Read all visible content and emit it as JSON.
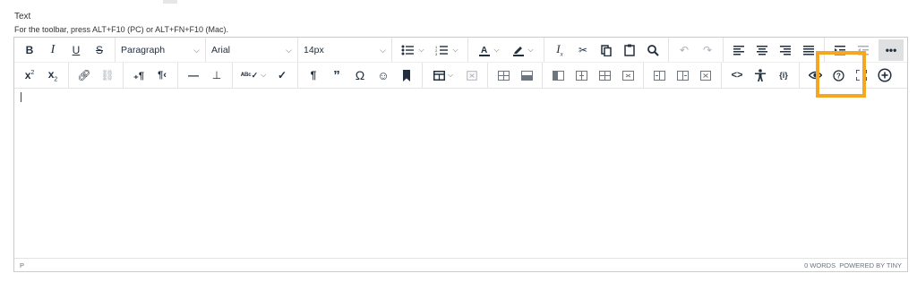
{
  "field": {
    "label": "Text",
    "hint": "For the toolbar, press ALT+F10 (PC) or ALT+FN+F10 (Mac)."
  },
  "toolbar": {
    "bold": "B",
    "italic": "I",
    "underline": "U",
    "strike": "S",
    "block_format": "Paragraph",
    "font_family": "Arial",
    "font_size": "14px",
    "more_label": "•••"
  },
  "statusbar": {
    "path": "P",
    "words": "0 WORDS",
    "powered": "POWERED BY TINY"
  },
  "icons": [
    "bold",
    "italic",
    "underline",
    "strikethrough",
    "bullet-list",
    "numbered-list",
    "text-color",
    "highlight",
    "clear-format",
    "cut",
    "copy",
    "paste",
    "find",
    "undo",
    "redo",
    "align-left",
    "align-center",
    "align-right",
    "justify",
    "indent",
    "outdent",
    "more",
    "superscript",
    "subscript",
    "link",
    "unlink",
    "ltr",
    "rtl",
    "horizontal-line",
    "insert-below",
    "spellcheck",
    "checkmark",
    "paragraph",
    "quote",
    "omega",
    "emoji",
    "bookmark",
    "table",
    "table-props",
    "cells",
    "accessibility",
    "code",
    "preview",
    "help",
    "fullscreen",
    "add-content"
  ],
  "colors": {
    "highlight": "#f5a623",
    "toolbar_text": "#222f3e",
    "border": "#cccccc"
  }
}
